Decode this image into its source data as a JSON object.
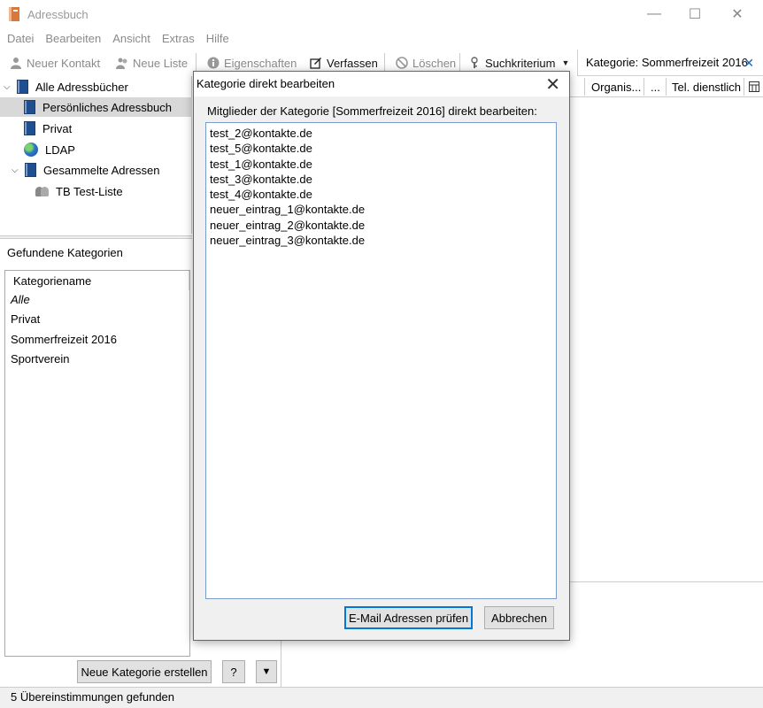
{
  "window": {
    "title": "Adressbuch",
    "minimize": "—",
    "maximize": "☐",
    "close": "✕"
  },
  "menu": [
    "Datei",
    "Bearbeiten",
    "Ansicht",
    "Extras",
    "Hilfe"
  ],
  "toolbar": {
    "new_contact": "Neuer Kontakt",
    "new_list": "Neue Liste",
    "properties": "Eigenschaften",
    "compose": "Verfassen",
    "delete": "Löschen",
    "search_criteria": "Suchkriterium"
  },
  "tab": {
    "label": "Kategorie: Sommerfreizeit 2016",
    "close": "✕"
  },
  "tree": {
    "root": "Alle Adressbücher",
    "items": [
      "Persönliches Adressbuch",
      "Privat",
      "LDAP",
      "Gesammelte Adressen",
      "TB Test-Liste"
    ]
  },
  "categories": {
    "header": "Gefundene Kategorien",
    "column": "Kategoriename",
    "rows": [
      "Alle",
      "Privat",
      "Sommerfreizeit 2016",
      "Sportverein"
    ],
    "new_button": "Neue Kategorie erstellen",
    "help_button": "?",
    "menu_button": "▼"
  },
  "results_columns": [
    "Organis...",
    "...",
    "Tel. dienstlich"
  ],
  "status": "5 Übereinstimmungen gefunden",
  "dialog": {
    "title": "Kategorie direkt bearbeiten",
    "close": "✕",
    "label": "Mitglieder der Kategorie [Sommerfreizeit 2016] direkt bearbeiten:",
    "lines": [
      "test_2@kontakte.de",
      "test_5@kontakte.de",
      "test_1@kontakte.de",
      "test_3@kontakte.de",
      "test_4@kontakte.de",
      "neuer_eintrag_1@kontakte.de",
      "neuer_eintrag_2@kontakte.de",
      "neuer_eintrag_3@kontakte.de"
    ],
    "check_button": "E-Mail Adressen prüfen",
    "cancel_button": "Abbrechen"
  }
}
